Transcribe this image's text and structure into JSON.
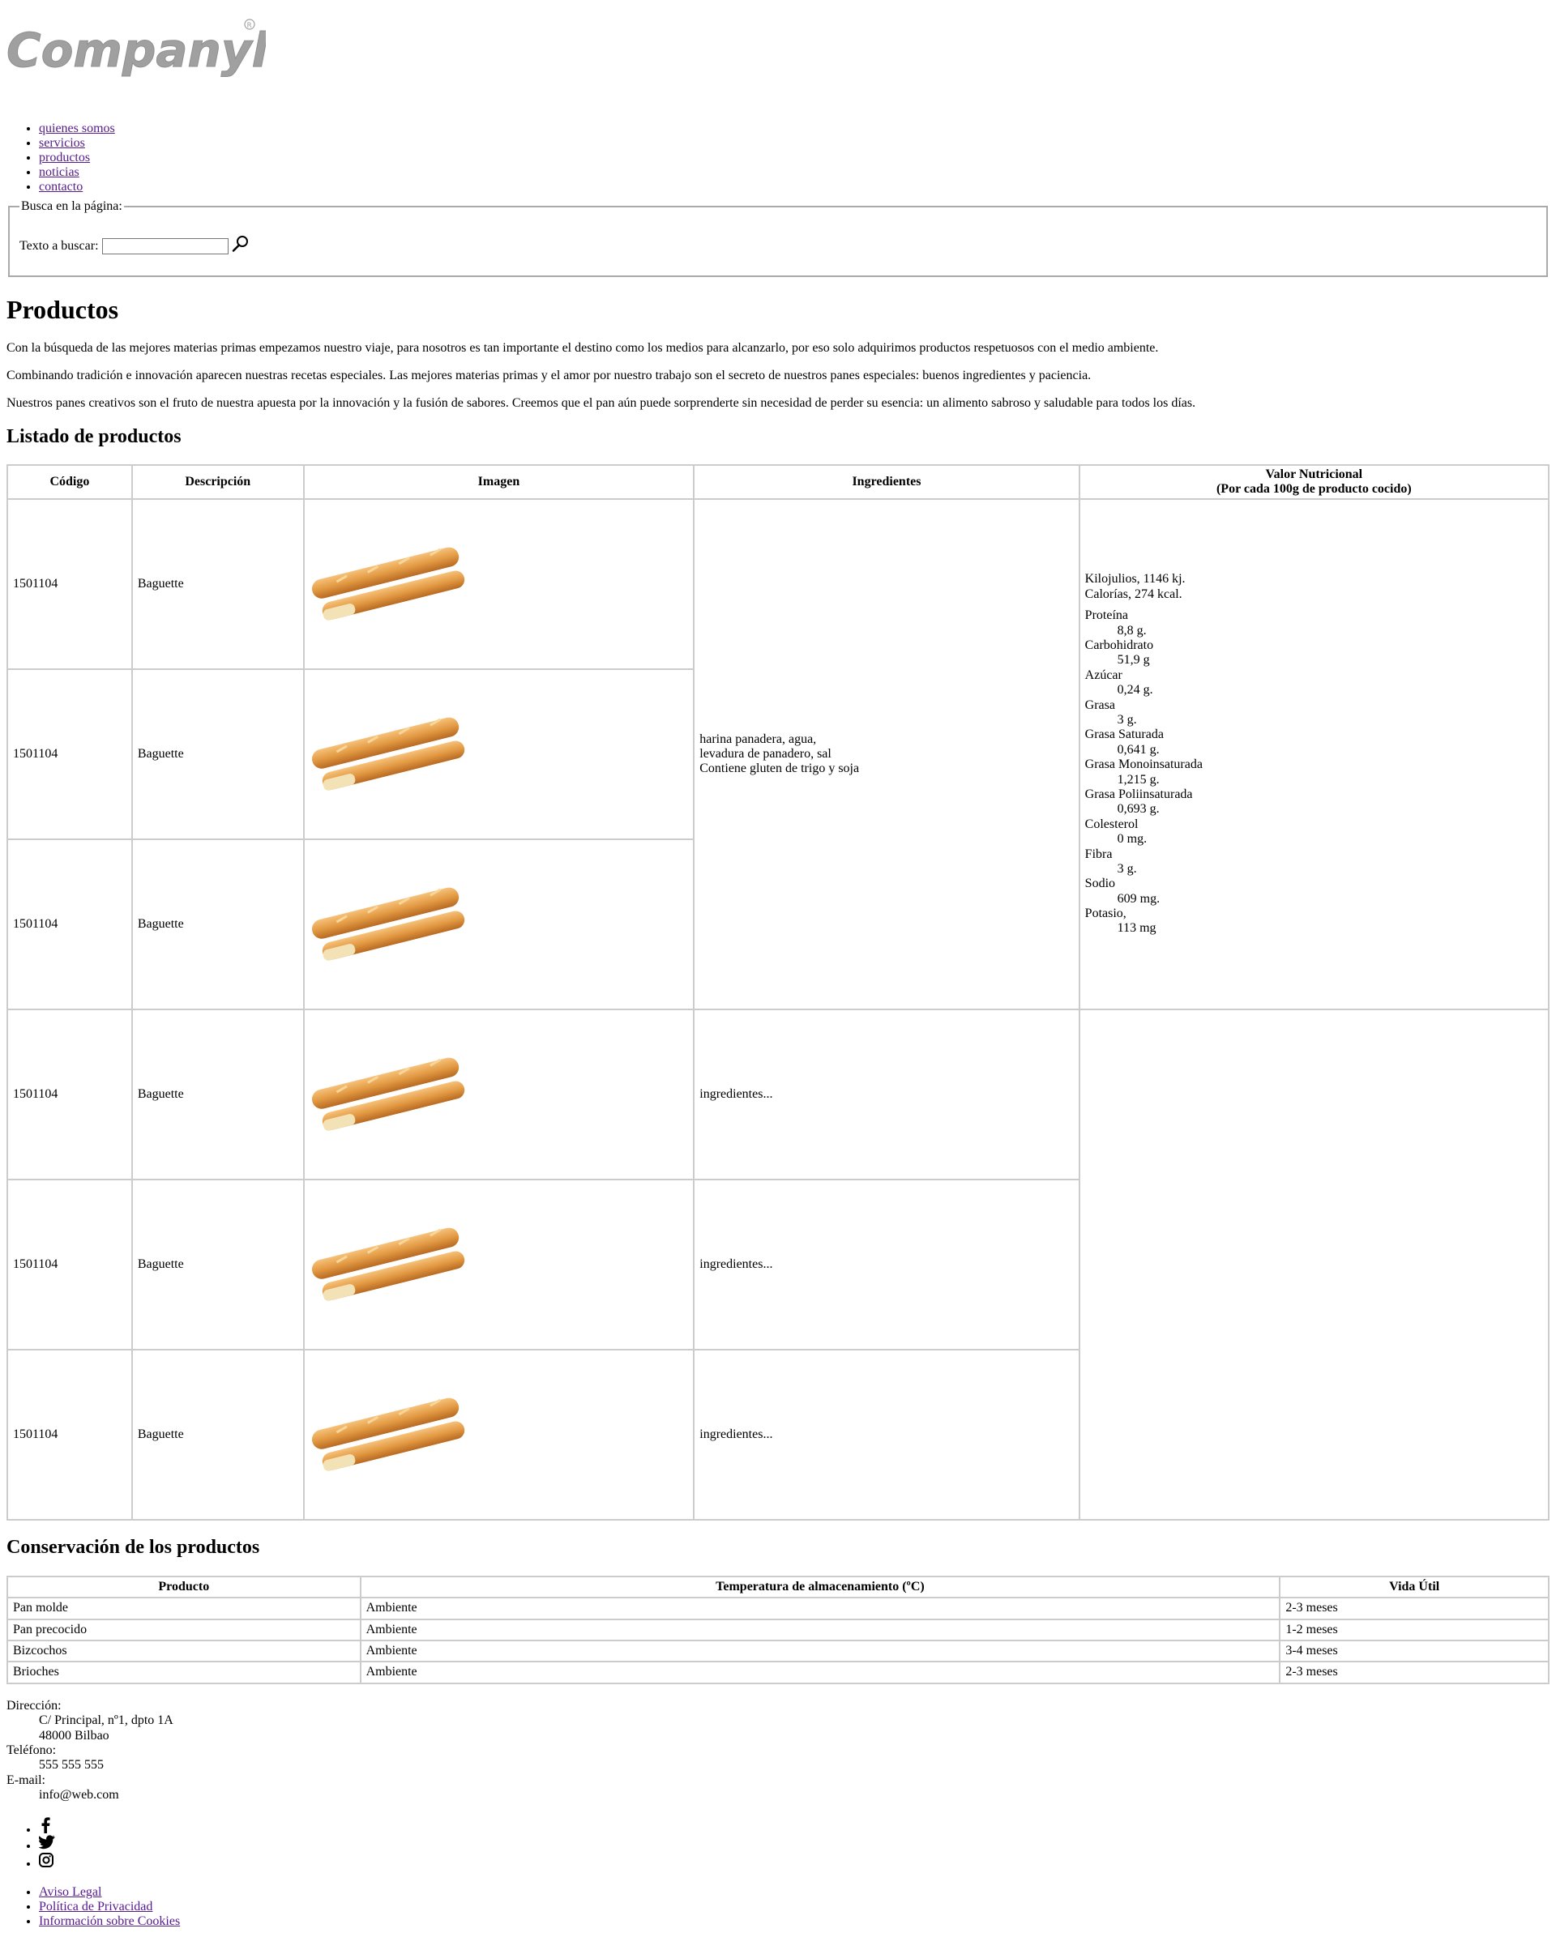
{
  "logo": {
    "text": "Companylogo"
  },
  "nav": {
    "items": [
      "quienes somos",
      "servicios",
      "productos",
      "noticias",
      "contacto"
    ]
  },
  "search": {
    "legend": "Busca en la página:",
    "label": "Texto a buscar:",
    "value": "",
    "button_icon": "search-icon"
  },
  "page": {
    "title": "Productos",
    "paragraphs": [
      "Con la búsqueda de las mejores materias primas empezamos nuestro viaje, para nosotros es tan importante el destino como los medios para alcanzarlo, por eso solo adquirimos productos respetuosos con el medio ambiente.",
      "Combinando tradición e innovación aparecen nuestras recetas especiales. Las mejores materias primas y el amor por nuestro trabajo son el secreto de nuestros panes especiales: buenos ingredientes y paciencia.",
      "Nuestros panes creativos son el fruto de nuestra apuesta por la innovación y la fusión de sabores. Creemos que el pan aún puede sorprenderte sin necesidad de perder su esencia: un alimento sabroso y saludable para todos los días."
    ]
  },
  "products": {
    "heading": "Listado de productos",
    "columns": [
      "Código",
      "Descripción",
      "Imagen",
      "Ingredientes",
      "Valor Nutricional",
      "(Por cada 100g de producto cocido)"
    ],
    "rows": [
      {
        "code": "1501104",
        "desc": "Baguette"
      },
      {
        "code": "1501104",
        "desc": "Baguette"
      },
      {
        "code": "1501104",
        "desc": "Baguette"
      },
      {
        "code": "1501104",
        "desc": "Baguette"
      },
      {
        "code": "1501104",
        "desc": "Baguette"
      },
      {
        "code": "1501104",
        "desc": "Baguette"
      }
    ],
    "ingredients_main": [
      "harina panadera, agua,",
      "levadura de panadero, sal",
      "Contiene gluten de trigo y soja"
    ],
    "ingredients_other": "ingredientes...",
    "nutrition": {
      "energy": [
        "Kilojulios, 1146 kj.",
        "Calorías, 274 kcal."
      ],
      "items": [
        {
          "name": "Proteína",
          "value": "8,8 g."
        },
        {
          "name": "Carbohidrato",
          "value": "51,9 g"
        },
        {
          "name": "Azúcar",
          "value": "0,24 g."
        },
        {
          "name": "Grasa",
          "value": "3 g."
        },
        {
          "name": "Grasa Saturada",
          "value": "0,641 g."
        },
        {
          "name": "Grasa Monoinsaturada",
          "value": "1,215 g."
        },
        {
          "name": "Grasa Poliinsaturada",
          "value": "0,693 g."
        },
        {
          "name": "Colesterol",
          "value": "0 mg."
        },
        {
          "name": "Fibra",
          "value": "3 g."
        },
        {
          "name": "Sodio",
          "value": "609 mg."
        },
        {
          "name": "Potasio,",
          "value": "113 mg"
        }
      ]
    }
  },
  "conservation": {
    "heading": "Conservación de los productos",
    "columns": [
      "Producto",
      "Temperatura de almacenamiento (ºC)",
      "Vida Útil"
    ],
    "rows": [
      [
        "Pan molde",
        "Ambiente",
        "2-3 meses"
      ],
      [
        "Pan precocido",
        "Ambiente",
        "1-2 meses"
      ],
      [
        "Bizcochos",
        "Ambiente",
        "3-4 meses"
      ],
      [
        "Brioches",
        "Ambiente",
        "2-3 meses"
      ]
    ]
  },
  "contact": {
    "address_label": "Dirección:",
    "address_lines": [
      "C/ Principal, nº1, dpto 1A",
      "48000 Bilbao"
    ],
    "phone_label": "Teléfono:",
    "phone": "555 555 555",
    "email_label": "E-mail:",
    "email": "info@web.com"
  },
  "social": {
    "icons": [
      "facebook-icon",
      "twitter-icon",
      "instagram-icon"
    ]
  },
  "legal": {
    "links": [
      "Aviso Legal",
      "Política de Privacidad",
      "Información sobre Cookies"
    ]
  }
}
